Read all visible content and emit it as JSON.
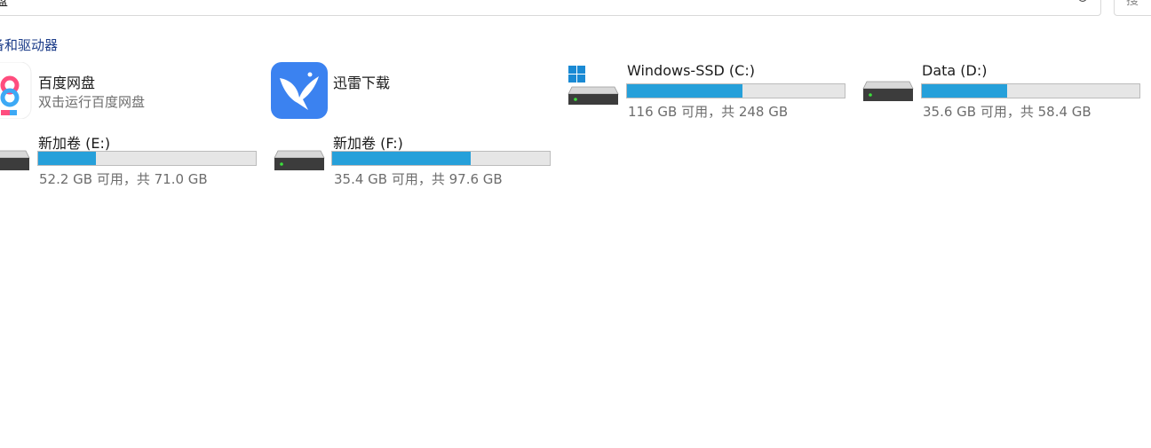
{
  "address_bar": {
    "path_fragment": "盘"
  },
  "search": {
    "placeholder": "搜"
  },
  "section": {
    "title": "备和驱动器"
  },
  "apps": [
    {
      "name": "百度网盘",
      "subtitle": "双击运行百度网盘",
      "icon": "baidu-netdisk-icon"
    },
    {
      "name": "迅雷下载",
      "icon": "xunlei-bird-icon"
    }
  ],
  "drives": [
    {
      "name": "Windows-SSD (C:)",
      "usage_text": "116 GB 可用，共 248 GB",
      "used_fraction": 0.532,
      "os_drive": true
    },
    {
      "name": "Data (D:)",
      "usage_text": "35.6 GB 可用，共 58.4 GB",
      "used_fraction": 0.39
    },
    {
      "name": "新加卷 (E:)",
      "usage_text": "52.2 GB 可用，共 71.0 GB",
      "used_fraction": 0.265
    },
    {
      "name": "新加卷 (F:)",
      "usage_text": "35.4 GB 可用，共 97.6 GB",
      "used_fraction": 0.637
    }
  ],
  "colors": {
    "bar_fill": "#26a0da",
    "bar_track": "#e6e6e6",
    "section_title": "#1e3e8a",
    "secondary_text": "#6d6d6d",
    "xunlei_bg": "#3b82f0"
  }
}
